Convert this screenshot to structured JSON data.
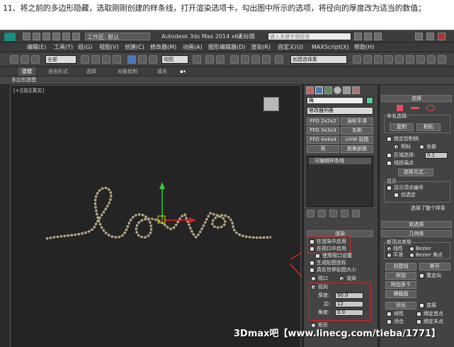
{
  "caption": "11、将之前的多边形隐藏，选取刚刚创建的样条线，打开渲染选项卡，勾出图中所示的选项，将径向的厚度改为适当的数值；",
  "titlebar": {
    "workspace": "工作区: 默认",
    "title": "Autodesk 3ds Max 2014 x64",
    "file": "无标题",
    "search_placeholder": "键入关键字或短语"
  },
  "menu": [
    "编辑(E)",
    "工具(T)",
    "组(G)",
    "视图(V)",
    "创建(C)",
    "修改器(M)",
    "动画(A)",
    "图形编辑器(D)",
    "渲染(R)",
    "自定义(U)",
    "MAXScript(X)",
    "帮助(H)"
  ],
  "toolbar": {
    "selection_filter": "全部",
    "view_dropdown": "视图",
    "named_selection": "创建选择集"
  },
  "ribbon": {
    "tabs": [
      "建模",
      "自由形式",
      "选择",
      "对象绘制",
      "填充"
    ],
    "sub": "多边形建模"
  },
  "viewport": {
    "label": "[+][前][真实]"
  },
  "cmd": {
    "object_name": "梅",
    "modifier_list": "修改器列表",
    "mod_buttons": [
      "FFD 2x2x2",
      "涡轮平滑",
      "FFD 3x3x3",
      "车削",
      "FFD 4x4x4",
      "UVW 贴图",
      "壳",
      "剖角剖面"
    ],
    "stack_item": "可编辑样条线",
    "render": {
      "title": "渲染",
      "enable_render": "在渲染中启用",
      "enable_viewport": "在视口中启用",
      "use_viewport": "使用视口设置",
      "gen_map": "生成贴图坐标",
      "real_world": "真实世界贴图大小",
      "viewport": "视口",
      "renderer": "渲染",
      "radial": "径向",
      "thickness_label": "厚度:",
      "thickness": "90.0",
      "sides_label": "边:",
      "sides": "12",
      "angle_label": "角度:",
      "angle": "0.0",
      "rect": "矩形"
    }
  },
  "right": {
    "selection": "选择",
    "named_sel": "命名选择:",
    "copy": "复制",
    "paste": "粘贴",
    "lock_handles": "锁定控制柄",
    "similar": "相似",
    "all": "全部",
    "area_sel": "区域选择:",
    "area_val": "0.1",
    "segment_end": "线段端点",
    "select_by": "选择方式...",
    "display": "显示",
    "show_vertex_num": "显示顶点编号",
    "only_selected": "仅选定",
    "status": "选择了整个样条",
    "soft_sel": "软选择",
    "geometry": "几何体",
    "new_vertex_type": "新顶点类型",
    "linear": "线性",
    "bezier": "Bezier",
    "smooth": "平滑",
    "bezier_corner": "Bezier 角点",
    "create_line": "创建线",
    "break": "断开",
    "attach": "附加",
    "reorient": "重定向",
    "attach_mult": "附加多个",
    "cross_section": "横截面",
    "optimize": "优化",
    "connect": "连接",
    "linear2": "线性",
    "bind_first": "绑定首点",
    "closed": "闭合",
    "bind_last": "绑定末点"
  },
  "watermark": "3Dmax吧【www.linecg.com/tieba/1771】",
  "colors": {
    "annot": "#dd2222",
    "spline": "#e8dcc0",
    "accent": "#e84a5f"
  }
}
